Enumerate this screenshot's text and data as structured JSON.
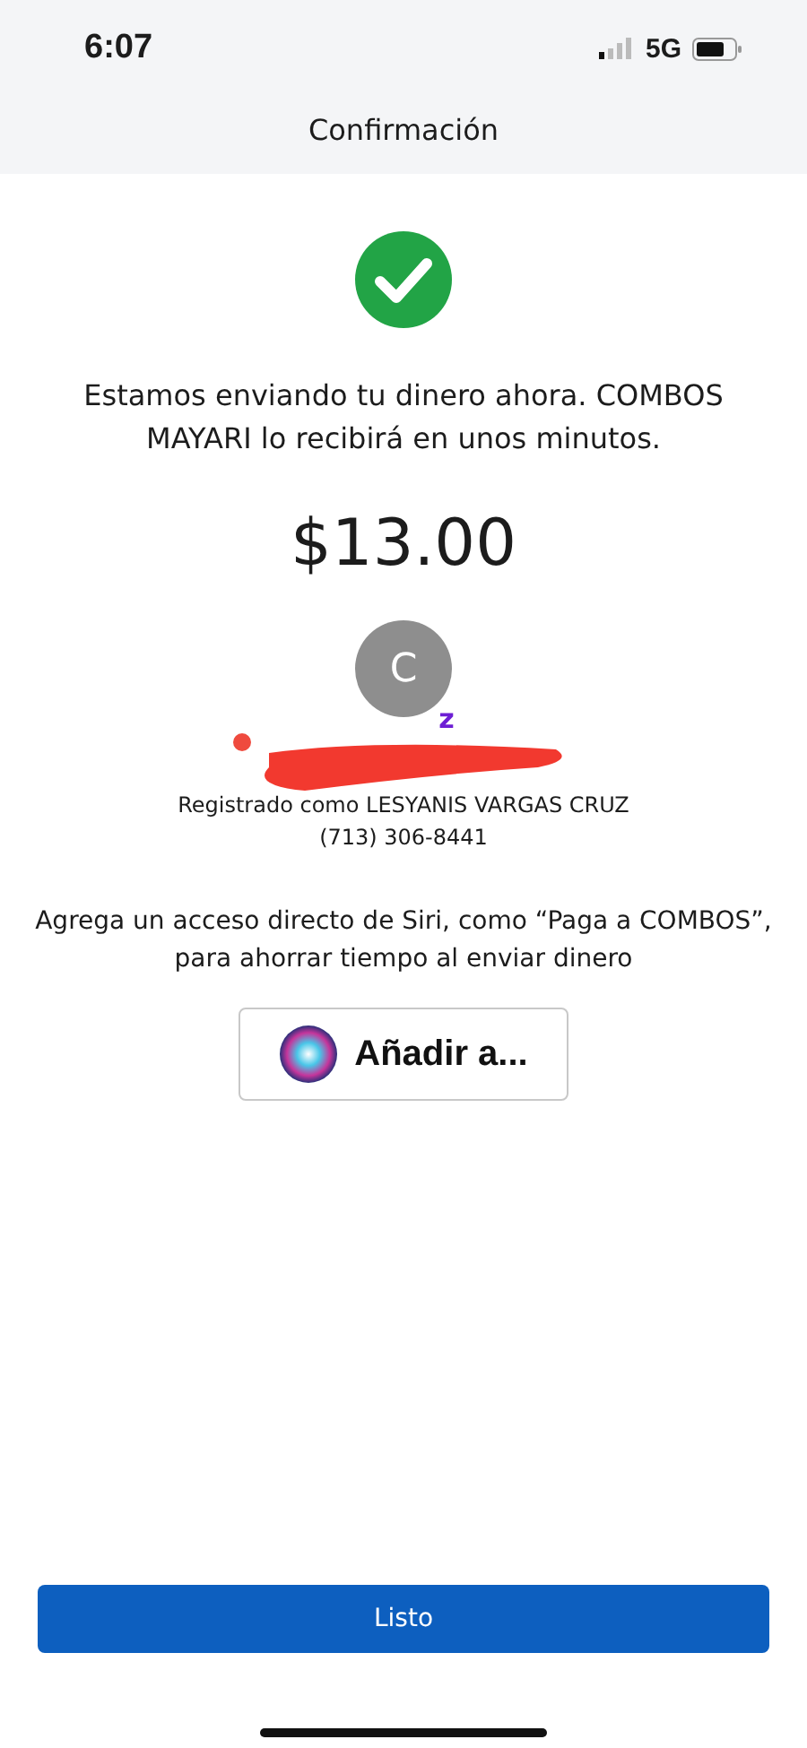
{
  "status_bar": {
    "time": "6:07",
    "network": "5G"
  },
  "header": {
    "title": "Confirmación"
  },
  "message": "Estamos enviando tu dinero ahora. COMBOS MAYARI lo recibirá en unos minutos.",
  "amount": "$13.00",
  "recipient": {
    "initial": "C",
    "badge": "z",
    "registered": "Registrado como LESYANIS VARGAS CRUZ",
    "phone": "(713) 306-8441"
  },
  "siri": {
    "text": "Agrega un acceso directo de Siri, como “Paga a COMBOS”, para ahorrar tiempo al enviar dinero",
    "button": "Añadir a..."
  },
  "done_button": "Listo"
}
